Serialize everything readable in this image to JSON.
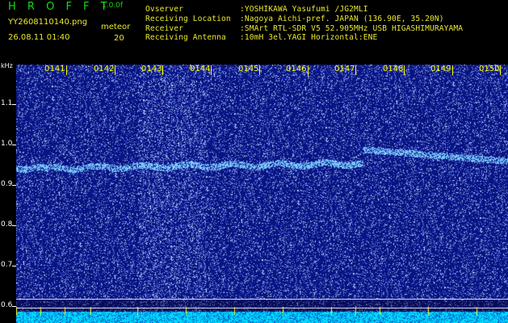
{
  "header": {
    "brand": "H R O F F T",
    "version": "1.0.0f",
    "filename": "YY2608110140.png",
    "datetime": "26.08.11 01:40",
    "event_label": "meteor",
    "event_count": "20",
    "observer_label": "Ovserver",
    "observer_value": ":YOSHIKAWA Yasufumi /JG2MLI",
    "location_label": "Receiving Location",
    "location_value": ":Nagoya Aichi-pref. JAPAN (136.90E, 35.20N)",
    "receiver_label": "Receiver",
    "receiver_value": ":SMArt RTL-SDR V5 52.905MHz USB HIGASHIMURAYAMA",
    "antenna_label": "Receiving Antenna",
    "antenna_value": ":10mH 3el.YAGI Horizontal:ENE"
  },
  "axis": {
    "unit": "kHz",
    "ticks": [
      "1.1",
      "1.0",
      "0.9",
      "0.8",
      "0.7",
      "0.6"
    ],
    "time_marks": [
      "0141",
      "0142",
      "0143",
      "0144",
      "0145",
      "0146",
      "0147",
      "0148",
      "0149",
      "0150"
    ]
  },
  "colors": {
    "header_green": "#18d818",
    "header_yellow": "#e8e830",
    "background_blue": "#0a1a8c",
    "noise_blue": "#4c6cff",
    "signal_cyan": "#00e8ff"
  }
}
